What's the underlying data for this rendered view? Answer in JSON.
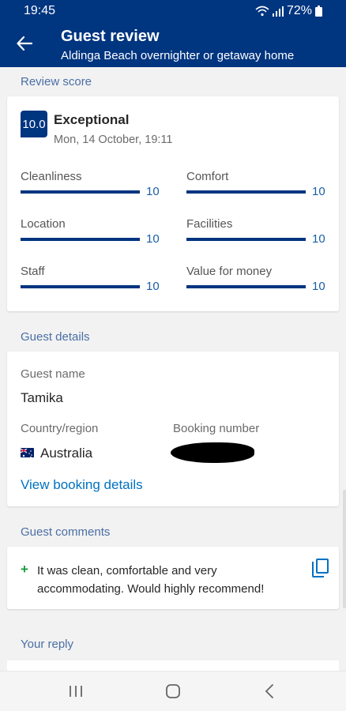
{
  "status": {
    "time": "19:45",
    "battery": "72%"
  },
  "header": {
    "title": "Guest review",
    "subtitle": "Aldinga Beach overnighter or getaway home"
  },
  "review": {
    "section_title": "Review score",
    "score": "10.0",
    "rating_word": "Exceptional",
    "date": "Mon, 14 October, 19:11",
    "max_score": 10,
    "metrics": [
      {
        "label": "Cleanliness",
        "value": "10",
        "fraction": 1.0
      },
      {
        "label": "Comfort",
        "value": "10",
        "fraction": 1.0
      },
      {
        "label": "Location",
        "value": "10",
        "fraction": 1.0
      },
      {
        "label": "Facilities",
        "value": "10",
        "fraction": 1.0
      },
      {
        "label": "Staff",
        "value": "10",
        "fraction": 1.0
      },
      {
        "label": "Value for money",
        "value": "10",
        "fraction": 1.0
      }
    ]
  },
  "guest": {
    "section_title": "Guest details",
    "name_label": "Guest name",
    "name": "Tamika",
    "country_label": "Country/region",
    "country": "Australia",
    "booking_label": "Booking number",
    "booking_link": "View booking details"
  },
  "comments": {
    "section_title": "Guest comments",
    "text": "It was clean, comfortable and very accommodating. Would highly recommend!"
  },
  "reply": {
    "section_title": "Your reply"
  },
  "colors": {
    "brand": "#003580",
    "link": "#0071c2",
    "positive": "#1a9e3a",
    "section": "#4a6fa5"
  },
  "icons": [
    "wifi-icon",
    "signal-icon",
    "battery-icon",
    "back-arrow-icon",
    "australia-flag-icon",
    "plus-icon",
    "copy-icon",
    "recent-apps-icon",
    "home-icon",
    "back-icon"
  ]
}
